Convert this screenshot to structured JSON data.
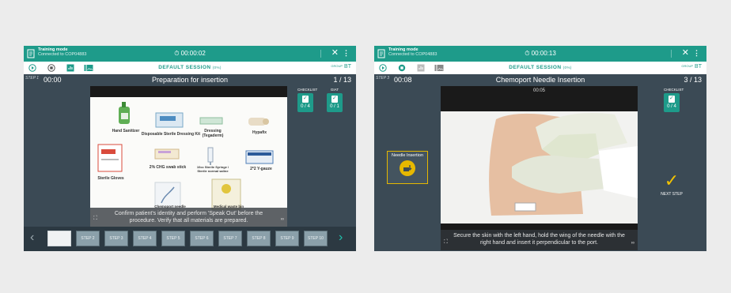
{
  "colors": {
    "accent": "#1e9b8a",
    "panel": "#3b4a55",
    "highlight": "#e6b800",
    "next_check": "#f3c300"
  },
  "left": {
    "topbar": {
      "mode": "Training mode",
      "connected": "Connected to COP04883",
      "timer": "00:00:02",
      "close_icon": "close-icon",
      "more_icon": "more-vertical-icon"
    },
    "session": {
      "title": "DEFAULT SESSION",
      "percent": "(0%)",
      "group_label": "GROUP",
      "group": "BT"
    },
    "step": {
      "label": "STEP 1",
      "time": "00:00",
      "title": "Preparation for insertion",
      "count": "1 / 13"
    },
    "tools": [
      {
        "label": "CHECKLIST",
        "count": "0 / 4"
      },
      {
        "label": "GIAT",
        "count": "0 / 1"
      }
    ],
    "supplies": [
      "Hand Sanitizer",
      "Disposable Sterile Dressing Kit",
      "Dressing (Tegaderm)",
      "Hypafix",
      "2% CHG swab stick",
      "10cc Sterile Syringe / Sterile normal saline",
      "2*2 Y-gauze",
      "Sterile Gloves",
      "Chemoport needle",
      "Medical waste bin"
    ],
    "caption": "Confirm patient's identity and perform 'Speak Out' before the procedure. Verify that all materials are prepared.",
    "thumbs": [
      "",
      "STEP 2",
      "STEP 3",
      "STEP 4",
      "STEP 5",
      "STEP 6",
      "STEP 7",
      "STEP 8",
      "STEP 9",
      "STEP 10"
    ]
  },
  "right": {
    "topbar": {
      "mode": "Training mode",
      "connected": "Connected to COP04883",
      "timer": "00:00:13",
      "close_icon": "close-icon",
      "more_icon": "more-vertical-icon"
    },
    "session": {
      "title": "DEFAULT SESSION",
      "percent": "(0%)",
      "group_label": "GROUP",
      "group": "BT"
    },
    "step": {
      "label": "STEP 3",
      "time": "00:08",
      "title": "Chemoport Needle Insertion",
      "count": "3 / 13"
    },
    "stage_timer": "00:05",
    "tools": [
      {
        "label": "CHECKLIST",
        "count": "0 / 4"
      }
    ],
    "side_task": "Needle Insertion",
    "next_step": "NEXT STEP",
    "caption": "Secure the skin with the left hand, hold the wing of the needle with the right hand and insert it perpendicular to the port."
  }
}
